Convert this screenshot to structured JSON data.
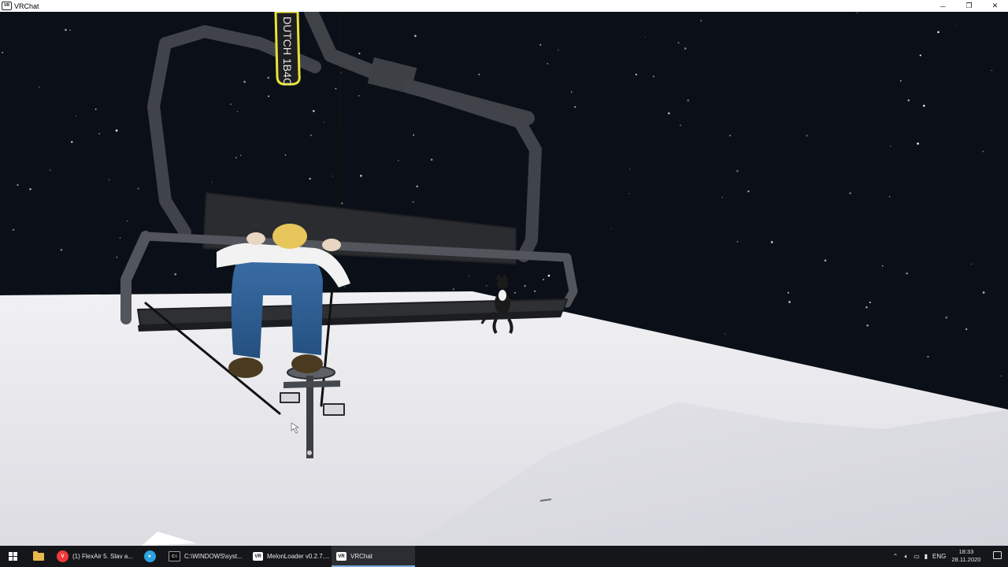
{
  "window": {
    "title": "VRChat",
    "icon_label": "VR",
    "controls": {
      "minimize": "─",
      "restore": "❐",
      "close": "✕"
    }
  },
  "scene": {
    "chairlift_sign": "DUTCH 1B4C"
  },
  "taskbar": {
    "tasks": [
      {
        "label": "(1) FlexAir 5. Slav a...",
        "icon": "vivaldi-icon"
      },
      {
        "label": "",
        "icon": "telegram-icon"
      },
      {
        "label": "C:\\WINDOWS\\syst...",
        "icon": "cmd-icon"
      },
      {
        "label": "MelonLoader v0.2.7....",
        "icon": "vr-icon"
      },
      {
        "label": "VRChat",
        "icon": "vr-icon",
        "active": true
      }
    ],
    "tray": {
      "language": "ENG",
      "time": "18:33",
      "date": "28.11.2020"
    }
  },
  "colors": {
    "sky": "#0b0f17",
    "snow": "#e8e8ec",
    "taskbar": "#15161a",
    "active_underline": "#7da7d9",
    "sign_yellow": "#e8e33a"
  }
}
